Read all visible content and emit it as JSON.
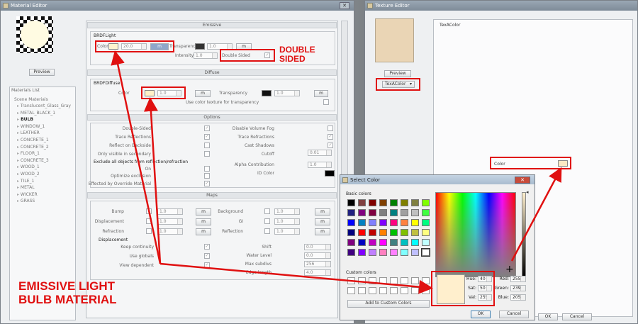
{
  "material_editor": {
    "title": "Material Editor",
    "preview_button": "Preview",
    "materials_list_label": "Materials List",
    "tree_root": "Scene Materials",
    "tree_items": [
      "Translucent_Glass_Gray",
      "METAL_BLACK_1",
      "BULB",
      "WINDOW_1",
      "LEATHER",
      "CONCRETE_1",
      "CONCRETE_2",
      "FLOOR_1",
      "CONCRETE_3",
      "WOOD_1",
      "WOOD_2",
      "TILE_1",
      "METAL",
      "WICKER",
      "GRASS"
    ],
    "emissive": {
      "header": "Emissive",
      "group_title": "BRDFLight",
      "color_label": "Color",
      "color_swatch": "#fff5d0",
      "color_value": "20.0",
      "m_button": "m",
      "transparency_label": "Transparency",
      "transparency_value": "1.0",
      "intensity_label": "Intensity",
      "intensity_value": "1.0",
      "double_sided_label": "Double Sided"
    },
    "diffuse": {
      "header": "Diffuse",
      "group_title": "BRDFDiffuse",
      "color_label": "Color",
      "color_swatch": "#fff0c8",
      "color_value": "1.0",
      "m_button": "m",
      "transparency_label": "Transparency",
      "transparency_value": "1.0",
      "use_color_texture_label": "Use color texture for transparency"
    },
    "options": {
      "header": "Options",
      "left": [
        "Double-Sided",
        "Trace Reflections",
        "Reflect on Backside",
        "Only visible in secondary"
      ],
      "right": [
        "Disable Volume Fog",
        "Trace Refractions",
        "Cast Shadows",
        "Cutoff"
      ],
      "cutoff_value": "0.01",
      "exclude_label": "Exclude all objects from reflection/refraction",
      "on_label": "On",
      "optimize_label": "Optimize exclusion",
      "effected_label": "Effected by Override Material",
      "alpha_label": "Alpha Contribution",
      "alpha_value": "1.0",
      "id_color_label": "ID Color"
    },
    "maps": {
      "header": "Maps",
      "left": [
        "Bump",
        "Displacement",
        "Refraction"
      ],
      "right": [
        "Background",
        "GI",
        "Reflection"
      ],
      "value": "1.0",
      "m_button": "m",
      "displacement_title": "Displacement",
      "disp_left": [
        "Keep continuity",
        "Use globals",
        "View dependent"
      ],
      "disp_right": [
        "Shift",
        "Water Level",
        "Max subdivs",
        "Edge length"
      ],
      "disp_values": [
        "0.0",
        "0.0",
        "256",
        "4.0"
      ]
    }
  },
  "texture_editor": {
    "title": "Texture Editor",
    "preview_button": "Preview",
    "dropdown_value": "TexAColor",
    "panel_label": "TexAColor",
    "color_label": "Color",
    "color_swatch": "#fbe9c4",
    "ok": "OK",
    "cancel": "Cancel"
  },
  "select_color": {
    "title": "Select Color",
    "basic_colors_label": "Basic colors",
    "custom_colors_label": "Custom colors",
    "add_custom_button": "Add to Custom Colors",
    "hue_label": "Hue:",
    "hue_value": "40",
    "sat_label": "Sat:",
    "sat_value": "50",
    "val_label": "Val:",
    "val_value": "255",
    "red_label": "Red:",
    "red_value": "255",
    "green_label": "Green:",
    "green_value": "239",
    "blue_label": "Blue:",
    "blue_value": "205",
    "ok": "OK",
    "cancel": "Cancel",
    "current_color": "#ffefcd",
    "basic_colors": [
      "#000000",
      "#804040",
      "#800000",
      "#804000",
      "#008000",
      "#808000",
      "#808040",
      "#80ff00",
      "#202080",
      "#800080",
      "#800040",
      "#808080",
      "#008080",
      "#a0a0a0",
      "#c0c0c0",
      "#40ff40",
      "#0000ff",
      "#0080c0",
      "#8080ff",
      "#8000ff",
      "#ff0080",
      "#ff8040",
      "#ffff00",
      "#00ff80",
      "#000080",
      "#ff0000",
      "#c00000",
      "#ff8000",
      "#00c000",
      "#80c000",
      "#c0c040",
      "#ffff80",
      "#800080",
      "#0000c0",
      "#c000c0",
      "#ff00ff",
      "#408080",
      "#00c0c0",
      "#00ffff",
      "#c0ffff",
      "#400080",
      "#8000ff",
      "#c080ff",
      "#ff80c0",
      "#ff80ff",
      "#80ffff",
      "#c0c0ff",
      "#ffffff"
    ]
  },
  "annotations": {
    "double_sided": "DOUBLE\nSIDED",
    "emissive_light": "EMISSIVE LIGHT\nBULB MATERIAL"
  }
}
